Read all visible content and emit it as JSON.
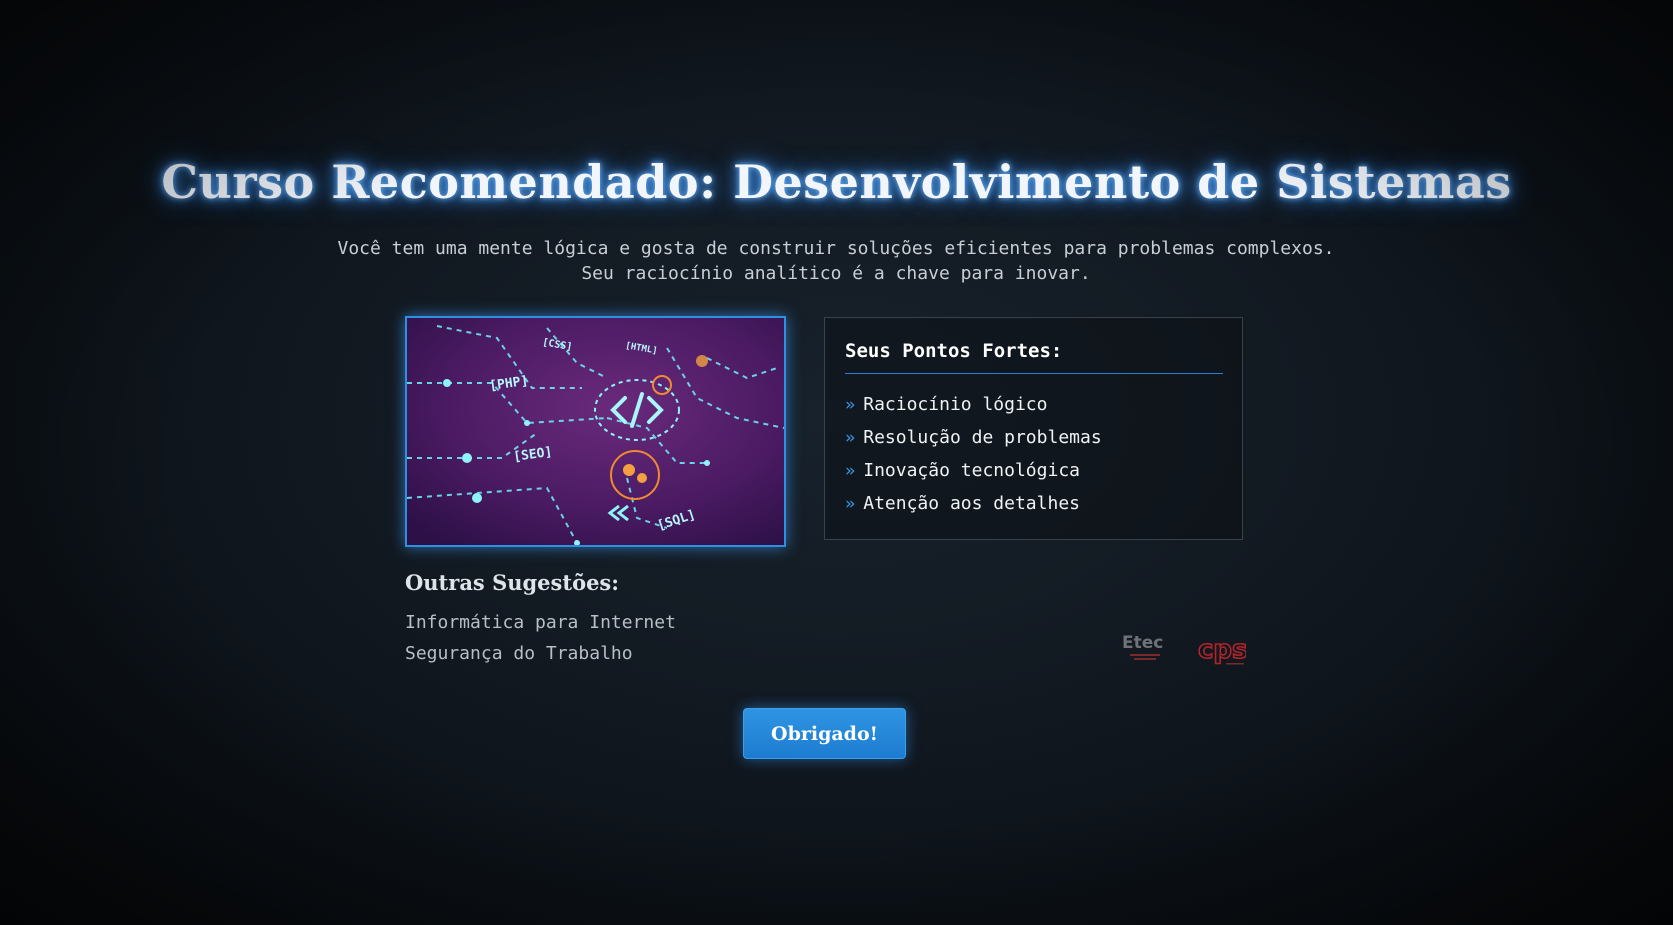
{
  "header": {
    "title": "Curso Recomendado: Desenvolvimento de Sistemas",
    "subtitle": "Você tem uma mente lógica e gosta de construir soluções eficientes para problemas complexos. Seu raciocínio analítico é a chave para inovar."
  },
  "hero_image": {
    "icon": "code-brackets-icon",
    "labels": [
      "[CSS]",
      "[PHP]",
      "[SEO]",
      "[SQL]",
      "[HTML]"
    ]
  },
  "strengths": {
    "title": "Seus Pontos Fortes:",
    "bullet_icon": "double-chevron-right-icon",
    "items": [
      "Raciocínio lógico",
      "Resolução de problemas",
      "Inovação tecnológica",
      "Atenção aos detalhes"
    ]
  },
  "others": {
    "title": "Outras Sugestões:",
    "items": [
      "Informática para Internet",
      "Segurança do Trabalho"
    ]
  },
  "logos": {
    "etec": "Etec",
    "cps": "cps"
  },
  "actions": {
    "thanks_label": "Obrigado!"
  },
  "colors": {
    "accent": "#2f94e3",
    "background": "#111820",
    "title_glow": "#3c8ee8",
    "cps_red": "#b0242a"
  }
}
